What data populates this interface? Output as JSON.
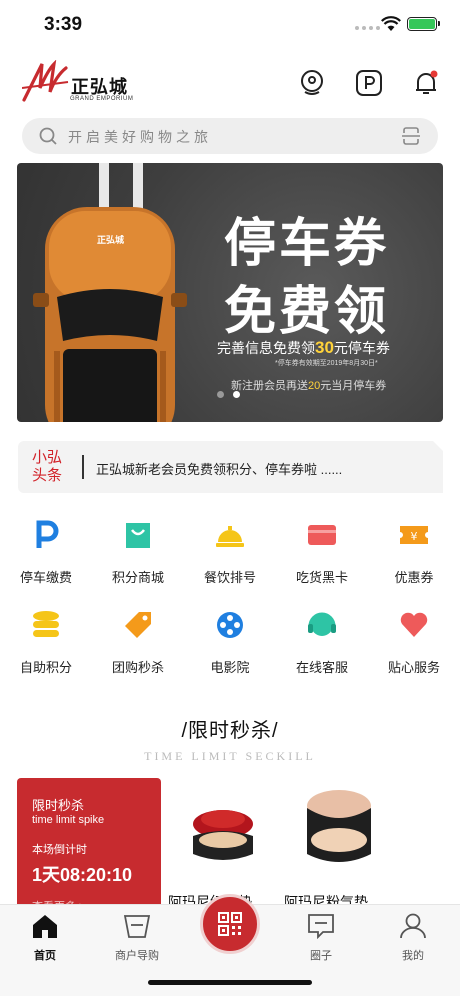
{
  "status": {
    "time": "3:39"
  },
  "header": {
    "logo_cn": "正弘城",
    "logo_en": "GRAND EMPORIUM"
  },
  "search": {
    "placeholder": "开启美好购物之旅"
  },
  "banner": {
    "title1": "停车券",
    "title2": "免费领",
    "line1_pre": "完善信息免费领",
    "line1_num": "30",
    "line1_post": "元停车券",
    "line1_note": "*停车券有效期至2019年8月30日*",
    "line2_pre": "新注册会员再送",
    "line2_num": "20",
    "line2_post": "元当月停车券",
    "car_logo": "正弘城"
  },
  "news": {
    "tag": "小弘头条",
    "text": "正弘城新老会员免费领积分、停车券啦 ......"
  },
  "grid": [
    {
      "label": "停车缴费",
      "icon": "parking-icon"
    },
    {
      "label": "积分商城",
      "icon": "shopping-bag-icon"
    },
    {
      "label": "餐饮排号",
      "icon": "dining-bell-icon"
    },
    {
      "label": "吃货黑卡",
      "icon": "card-icon"
    },
    {
      "label": "优惠券",
      "icon": "coupon-icon"
    },
    {
      "label": "自助积分",
      "icon": "coins-icon"
    },
    {
      "label": "团购秒杀",
      "icon": "tag-icon"
    },
    {
      "label": "电影院",
      "icon": "film-reel-icon"
    },
    {
      "label": "在线客服",
      "icon": "headset-icon"
    },
    {
      "label": "贴心服务",
      "icon": "heart-icon"
    }
  ],
  "seckill": {
    "title": "/限时秒杀/",
    "subtitle": "TIME LIMIT SECKILL",
    "card_title": "限时秒杀",
    "card_en": "time limit spike",
    "countdown_label": "本场倒计时",
    "countdown": "1天08:20:10",
    "more": "查看更多 >",
    "products": [
      {
        "name": "阿玛尼红气垫"
      },
      {
        "name": "阿玛尼粉气垫"
      }
    ]
  },
  "tabs": [
    {
      "label": "首页",
      "icon": "home-icon"
    },
    {
      "label": "商户导购",
      "icon": "basket-icon"
    },
    {
      "label": "",
      "icon": "qr-scan-icon"
    },
    {
      "label": "圈子",
      "icon": "chat-icon"
    },
    {
      "label": "我的",
      "icon": "user-icon"
    }
  ],
  "colors": {
    "brand_red": "#c72b2f",
    "blue": "#1f7fe0",
    "green": "#2ec4a5",
    "yellow": "#f5c518",
    "orange": "#f49a1a",
    "pink": "#ee5a5a"
  }
}
